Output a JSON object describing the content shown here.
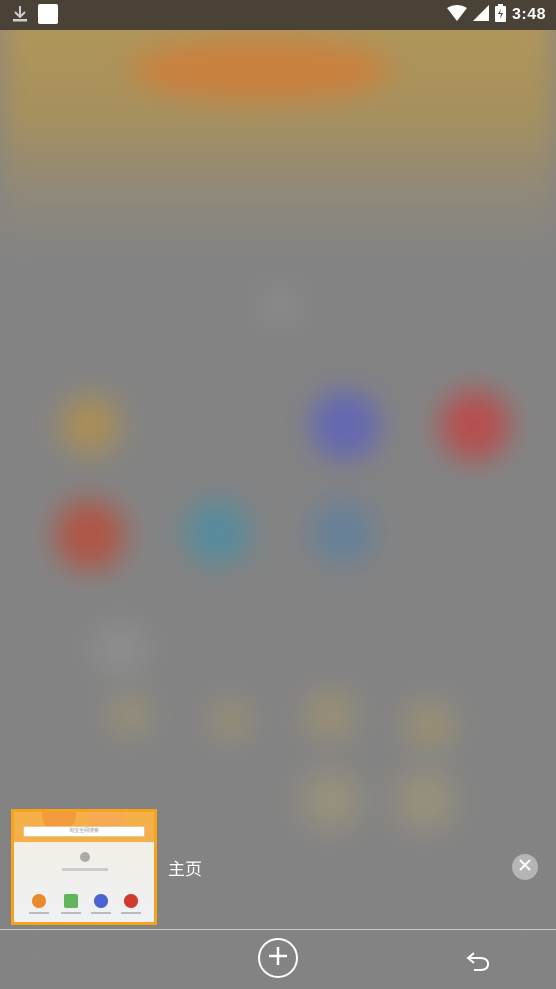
{
  "status_bar": {
    "time": "3:48",
    "left_icons": [
      "download-icon",
      "app-notification-icon"
    ],
    "right_icons": [
      "wifi-icon",
      "signal-icon",
      "battery-icon"
    ]
  },
  "tab_switcher": {
    "tabs": [
      {
        "title": "主页",
        "active": true,
        "thumbnail_search_text": "淘宝全网搜索"
      }
    ],
    "accent_color": "#f5a41b"
  },
  "toolbar": {
    "new_tab_icon": "plus-circle-icon",
    "back_icon": "undo-arrow-icon"
  }
}
